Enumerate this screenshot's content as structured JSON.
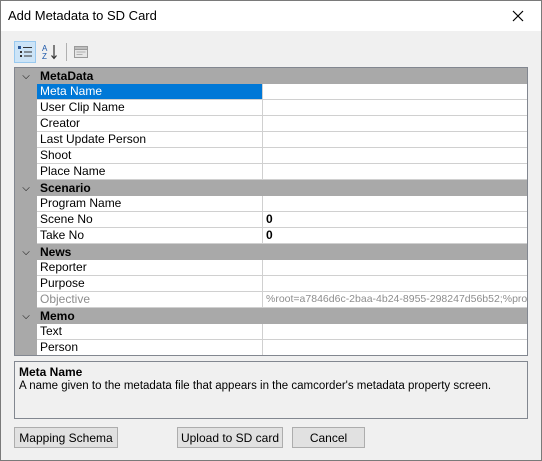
{
  "window": {
    "title": "Add Metadata to SD Card"
  },
  "toolbar": {
    "buttons": [
      {
        "name": "categorized-view",
        "icon": "categorized-icon"
      },
      {
        "name": "alphabetical-sort",
        "icon": "sort-az-icon"
      },
      {
        "name": "property-pages",
        "icon": "property-pages-icon"
      }
    ]
  },
  "grid": {
    "categories": [
      {
        "label": "MetaData",
        "rows": [
          {
            "name": "Meta Name",
            "value": ""
          },
          {
            "name": "User Clip Name",
            "value": ""
          },
          {
            "name": "Creator",
            "value": ""
          },
          {
            "name": "Last Update Person",
            "value": ""
          },
          {
            "name": "Shoot",
            "value": ""
          },
          {
            "name": "Place Name",
            "value": ""
          }
        ]
      },
      {
        "label": "Scenario",
        "rows": [
          {
            "name": "Program Name",
            "value": ""
          },
          {
            "name": "Scene No",
            "value": "0"
          },
          {
            "name": "Take No",
            "value": "0"
          }
        ]
      },
      {
        "label": "News",
        "rows": [
          {
            "name": "Reporter",
            "value": ""
          },
          {
            "name": "Purpose",
            "value": ""
          },
          {
            "name": "Objective",
            "value": "%root=a7846d6c-2baa-4b24-8955-298247d56b52;%pro"
          }
        ]
      },
      {
        "label": "Memo",
        "rows": [
          {
            "name": "Text",
            "value": ""
          },
          {
            "name": "Person",
            "value": ""
          }
        ]
      }
    ]
  },
  "description": {
    "title": "Meta Name",
    "text": "A name given to the metadata file that appears in the camcorder's metadata property screen."
  },
  "buttons": {
    "mapping_schema": "Mapping Schema",
    "upload": "Upload to SD card",
    "cancel": "Cancel"
  },
  "colors": {
    "selection": "#0078d7",
    "category_bg": "#a9a9a9"
  }
}
